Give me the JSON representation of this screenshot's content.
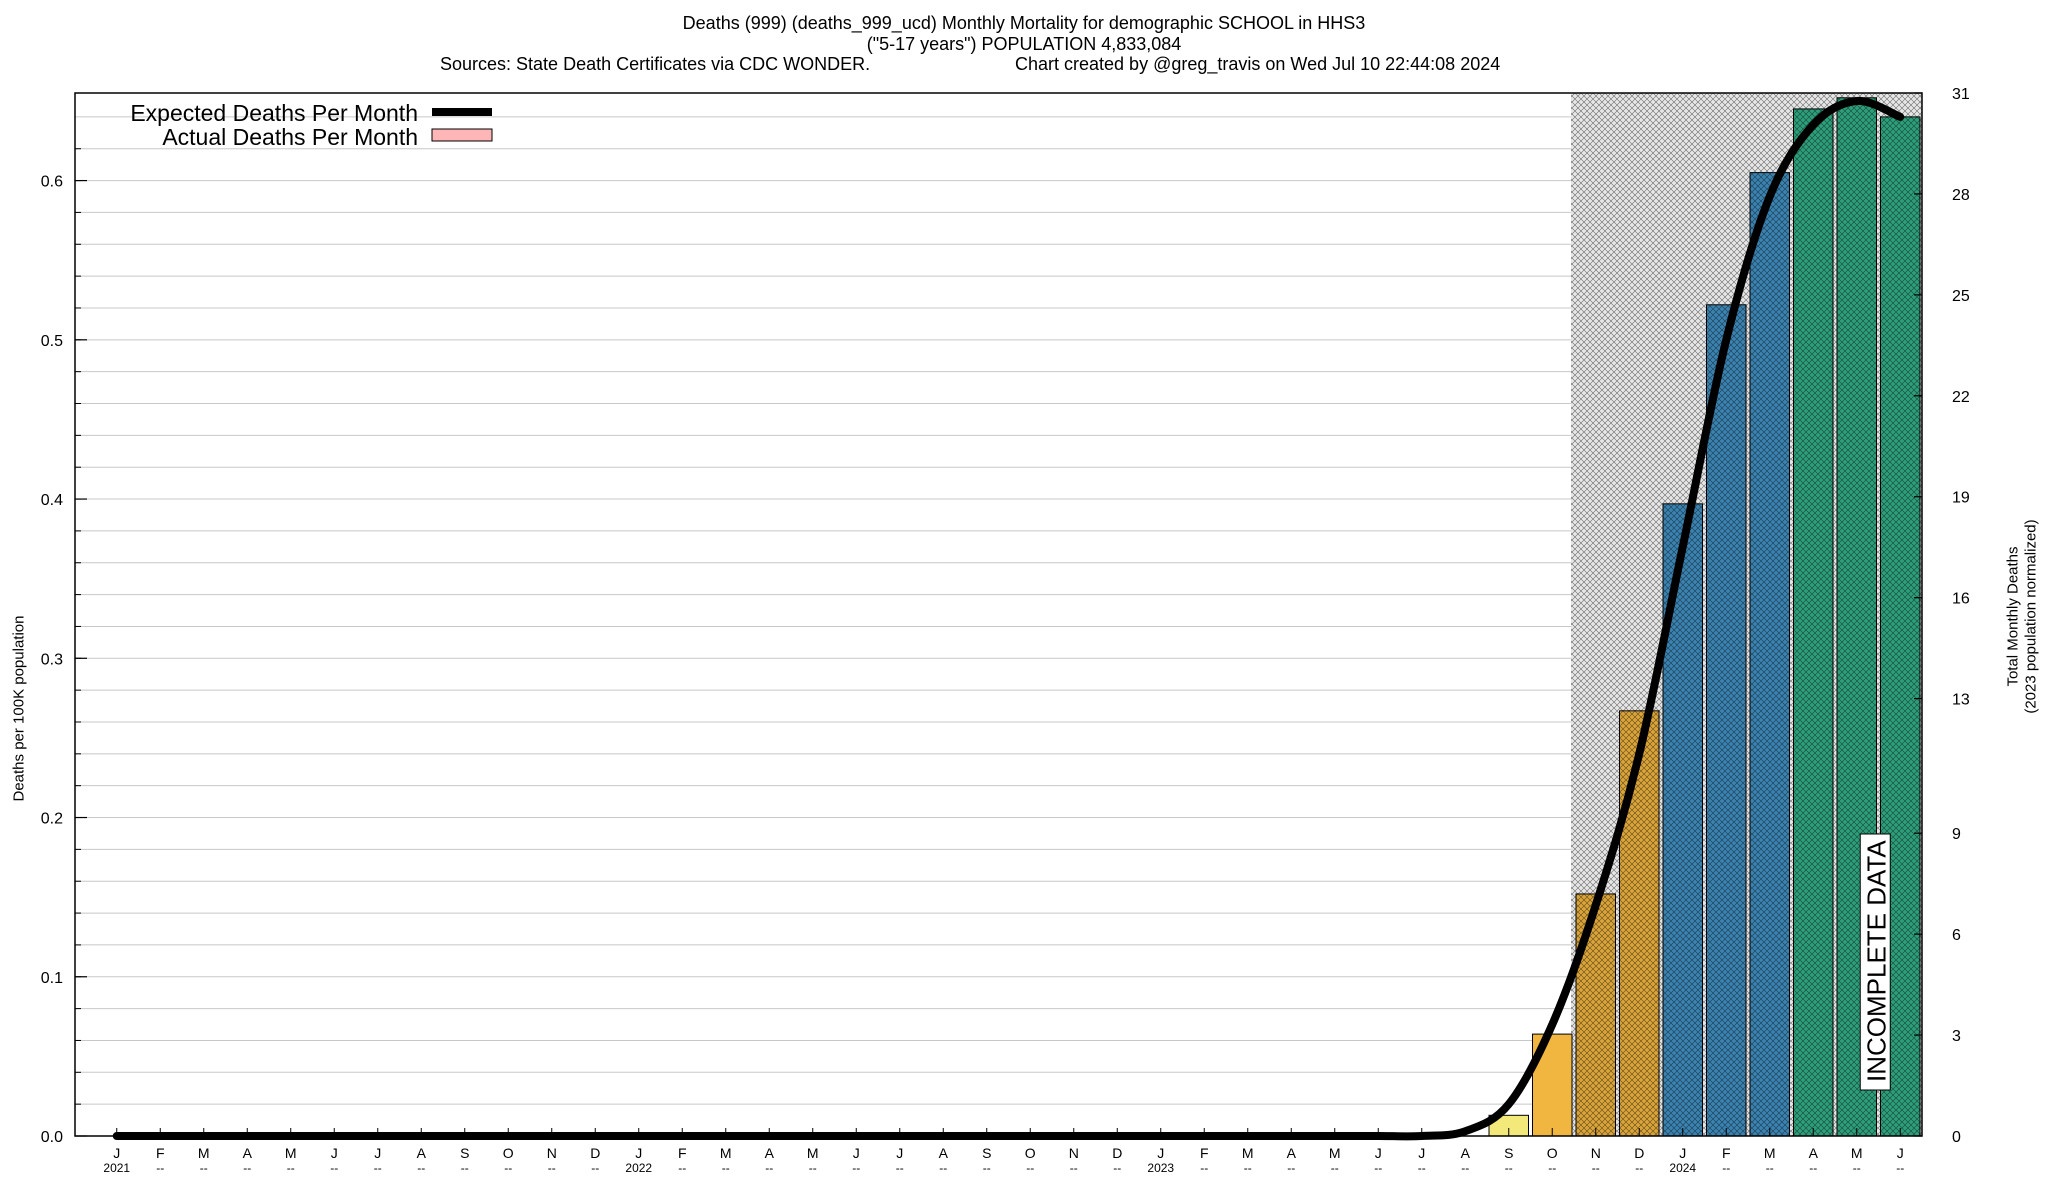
{
  "header": {
    "title_line1": "Deaths (999) (deaths_999_ucd) Monthly Mortality for demographic SCHOOL in HHS3",
    "title_line2": "(\"5-17 years\") POPULATION 4,833,084",
    "sources": "Sources: State Death Certificates via CDC WONDER.",
    "credit": "Chart created by @greg_travis on Wed Jul 10 22:44:08 2024"
  },
  "chart_data": {
    "type": "bar",
    "ylabel": "Deaths per 100K population",
    "y2label_line1": "Total Monthly Deaths",
    "y2label_line2": "(2023 population normalized)",
    "ylim": [
      0,
      0.655
    ],
    "y2lim": [
      0,
      31
    ],
    "yticks": [
      "0.0",
      "0.1",
      "0.2",
      "0.3",
      "0.4",
      "0.5",
      "0.6"
    ],
    "y2ticks": [
      "0",
      "3",
      "6",
      "9",
      "13",
      "16",
      "19",
      "22",
      "25",
      "28",
      "31"
    ],
    "grid": true,
    "legend_position": "top-left",
    "legend": {
      "expected": "Expected Deaths Per Month",
      "actual": "Actual Deaths Per Month"
    },
    "annotation": "INCOMPLETE DATA",
    "month_labels": [
      "J",
      "F",
      "M",
      "A",
      "M",
      "J",
      "J",
      "A",
      "S",
      "O",
      "N",
      "D",
      "J",
      "F",
      "M",
      "A",
      "M",
      "J",
      "J",
      "A",
      "S",
      "O",
      "N",
      "D",
      "J",
      "F",
      "M",
      "A",
      "M",
      "J",
      "J",
      "A",
      "S",
      "O",
      "N",
      "D",
      "J",
      "F",
      "M",
      "A",
      "M",
      "J"
    ],
    "year_labels": [
      "2021",
      "--",
      "--",
      "--",
      "--",
      "--",
      "--",
      "--",
      "--",
      "--",
      "--",
      "--",
      "2022",
      "--",
      "--",
      "--",
      "--",
      "--",
      "--",
      "--",
      "--",
      "--",
      "--",
      "--",
      "2023",
      "--",
      "--",
      "--",
      "--",
      "--",
      "--",
      "--",
      "--",
      "--",
      "--",
      "--",
      "2024",
      "--",
      "--",
      "--",
      "--",
      "--"
    ],
    "bars": [
      0,
      0,
      0,
      0,
      0,
      0,
      0,
      0,
      0,
      0,
      0,
      0,
      0,
      0,
      0,
      0,
      0,
      0,
      0,
      0,
      0,
      0,
      0,
      0,
      0,
      0,
      0,
      0,
      0,
      0,
      0,
      0,
      0.013,
      0.064,
      0.152,
      0.267,
      0.397,
      0.522,
      0.605,
      0.645,
      0.652,
      0.64
    ],
    "bar_colors": [
      "#f2e97a",
      "#f2e97a",
      "#f2e97a",
      "#f2e97a",
      "#f2e97a",
      "#f2e97a",
      "#f2e97a",
      "#f2e97a",
      "#f2e97a",
      "#f2e97a",
      "#f2e97a",
      "#f2e97a",
      "#f2e97a",
      "#f2e97a",
      "#f2e97a",
      "#f2e97a",
      "#f2e97a",
      "#f2e97a",
      "#f2e97a",
      "#f2e97a",
      "#f2e97a",
      "#f2e97a",
      "#f2e97a",
      "#f2e97a",
      "#f2e97a",
      "#f2e97a",
      "#f2e97a",
      "#f2e97a",
      "#f2e97a",
      "#f2e97a",
      "#f2e97a",
      "#f2e97a",
      "#f2e97a",
      "#f0b63f",
      "#d9a43a",
      "#d9a43a",
      "#3b82b0",
      "#3b82b0",
      "#3b82b0",
      "#2e9e7a",
      "#2e9e7a",
      "#2e9e7a"
    ],
    "expected": [
      0,
      0,
      0,
      0,
      0,
      0,
      0,
      0,
      0,
      0,
      0,
      0,
      0,
      0,
      0,
      0,
      0,
      0,
      0,
      0,
      0,
      0,
      0,
      0,
      0,
      0,
      0,
      0,
      0,
      0,
      0,
      0.003,
      0.02,
      0.07,
      0.145,
      0.24,
      0.37,
      0.5,
      0.59,
      0.635,
      0.65,
      0.64
    ],
    "incomplete_from_index": 34,
    "colors": {
      "expected_line": "#000000",
      "actual_legend": "#ffb6b6",
      "grid": "#c8c8c8",
      "hatch_bg": "#e6e6e6"
    }
  }
}
